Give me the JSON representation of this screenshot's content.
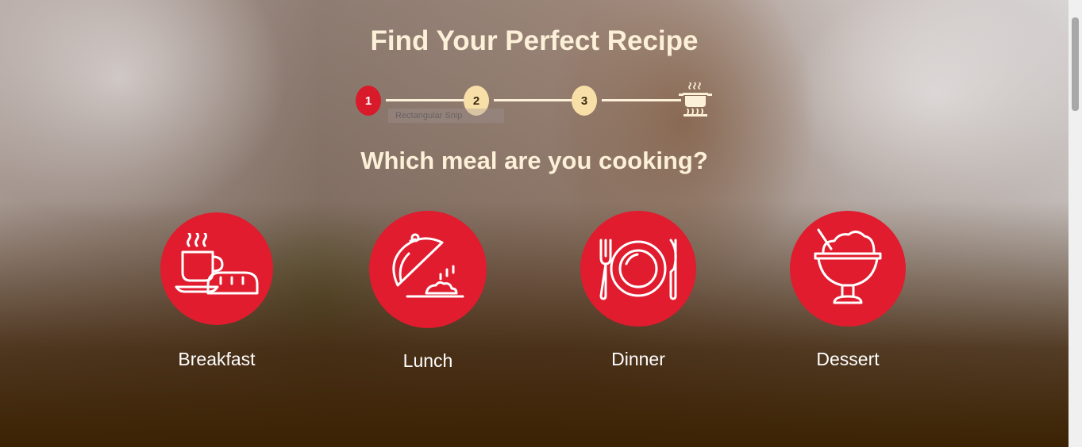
{
  "page": {
    "title": "Find Your Perfect Recipe",
    "question": "Which meal are you cooking?"
  },
  "stepper": {
    "steps": [
      "1",
      "2",
      "3"
    ],
    "active_step": 1,
    "final_icon": "cooking-pot-icon"
  },
  "overlay": {
    "snip_label": "Rectangular Snip"
  },
  "meals": [
    {
      "label": "Breakfast",
      "icon": "breakfast-coffee-bread-icon"
    },
    {
      "label": "Lunch",
      "icon": "lunch-cloche-dish-icon"
    },
    {
      "label": "Dinner",
      "icon": "dinner-plate-cutlery-icon"
    },
    {
      "label": "Dessert",
      "icon": "dessert-ice-cream-cup-icon"
    }
  ],
  "colors": {
    "accent_red": "#e01c2e",
    "active_step_red": "#d81a2a",
    "step_cream": "#f8dfa8",
    "heading_cream": "#fdf0d8"
  }
}
